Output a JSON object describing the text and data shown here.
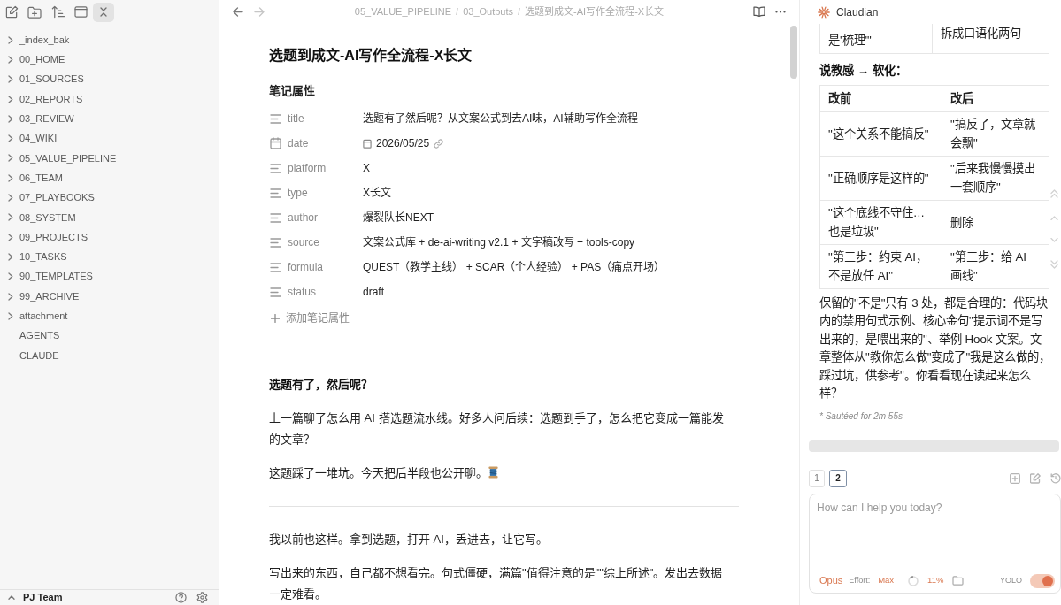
{
  "sidebar": {
    "items": [
      {
        "label": "_index_bak",
        "kind": "folder"
      },
      {
        "label": "00_HOME",
        "kind": "folder"
      },
      {
        "label": "01_SOURCES",
        "kind": "folder"
      },
      {
        "label": "02_REPORTS",
        "kind": "folder"
      },
      {
        "label": "03_REVIEW",
        "kind": "folder"
      },
      {
        "label": "04_WIKI",
        "kind": "folder"
      },
      {
        "label": "05_VALUE_PIPELINE",
        "kind": "folder"
      },
      {
        "label": "06_TEAM",
        "kind": "folder"
      },
      {
        "label": "07_PLAYBOOKS",
        "kind": "folder"
      },
      {
        "label": "08_SYSTEM",
        "kind": "folder"
      },
      {
        "label": "09_PROJECTS",
        "kind": "folder"
      },
      {
        "label": "10_TASKS",
        "kind": "folder"
      },
      {
        "label": "90_TEMPLATES",
        "kind": "folder"
      },
      {
        "label": "99_ARCHIVE",
        "kind": "folder"
      },
      {
        "label": "attachment",
        "kind": "folder"
      },
      {
        "label": "AGENTS",
        "kind": "file"
      },
      {
        "label": "CLAUDE",
        "kind": "file"
      }
    ],
    "footer": {
      "vault_name": "PJ Team"
    }
  },
  "editor": {
    "breadcrumb": {
      "parts": [
        "05_VALUE_PIPELINE",
        "03_Outputs",
        "选题到成文-AI写作全流程-X长文"
      ],
      "separator": "/"
    },
    "note_title": "选题到成文-AI写作全流程-X长文",
    "properties": {
      "heading": "笔记属性",
      "items": [
        {
          "key": "title",
          "value": "选题有了然后呢？从文案公式到去AI味，AI辅助写作全流程",
          "kind": "text"
        },
        {
          "key": "date",
          "value": "2026/05/25",
          "kind": "date"
        },
        {
          "key": "platform",
          "value": "X",
          "kind": "text"
        },
        {
          "key": "type",
          "value": "X长文",
          "kind": "text"
        },
        {
          "key": "author",
          "value": "爆裂队长NEXT",
          "kind": "text"
        },
        {
          "key": "source",
          "value": "文案公式库 + de-ai-writing v2.1 + 文字稿改写 + tools-copy",
          "kind": "text"
        },
        {
          "key": "formula",
          "value": "QUEST（教学主线） + SCAR（个人经验） + PAS（痛点开场）",
          "kind": "text"
        },
        {
          "key": "status",
          "value": "draft",
          "kind": "text"
        }
      ],
      "add_label": "添加笔记属性"
    },
    "body": [
      {
        "kind": "heading",
        "text": "选题有了，然后呢？"
      },
      {
        "kind": "paragraph",
        "text": "上一篇聊了怎么用 AI 搭选题流水线。好多人问后续：选题到手了，怎么把它变成一篇能发的文章？"
      },
      {
        "kind": "paragraph",
        "text": "这题踩了一堆坑。今天把后半段也公开聊。",
        "emoji": true
      },
      {
        "kind": "rule"
      },
      {
        "kind": "paragraph",
        "text": "我以前也这样。拿到选题，打开 AI，丢进去，让它写。"
      },
      {
        "kind": "paragraph",
        "text": "写出来的东西，自己都不想看完。句式僵硬，满篇\"值得注意的是\"\"综上所述\"。发出去数据一定难看。"
      }
    ]
  },
  "assistant": {
    "title": "Claudian",
    "previous_table": {
      "rows": [
        [
          "是'梳理'\"",
          "拆成口语化两句"
        ]
      ]
    },
    "section_heading": "说教感 → 软化：",
    "table": {
      "columns": [
        "改前",
        "改后"
      ],
      "rows": [
        [
          "\"这个关系不能搞反\"",
          "\"搞反了，文章就会飘\""
        ],
        [
          "\"正确顺序是这样的\"",
          "\"后来我慢慢摸出一套顺序\""
        ],
        [
          "\"这个底线不守住…也是垃圾\"",
          "删除"
        ],
        [
          "\"第三步：约束 AI，不是放任 AI\"",
          "\"第三步：给 AI 画线\""
        ]
      ]
    },
    "message": "保留的\"不是\"只有 3 处，都是合理的：代码块内的禁用句式示例、核心金句\"提示词不是写出来的，是喂出来的\"、举例 Hook 文案。文章整体从\"教你怎么做\"变成了\"我是这么做的，踩过坑，供参考\"。你看看现在读起来怎么样？",
    "duration_note": "* Sautéed for 2m 55s",
    "tabs": [
      {
        "label": "1",
        "selected": false
      },
      {
        "label": "2",
        "selected": true
      }
    ],
    "input": {
      "placeholder": "How can I help you today?"
    },
    "model": "Opus",
    "effort_label": "Effort:",
    "effort_value": "Max",
    "context_usage": {
      "reading": "11%"
    },
    "mode": {
      "label": "YOLO",
      "on": true
    }
  }
}
